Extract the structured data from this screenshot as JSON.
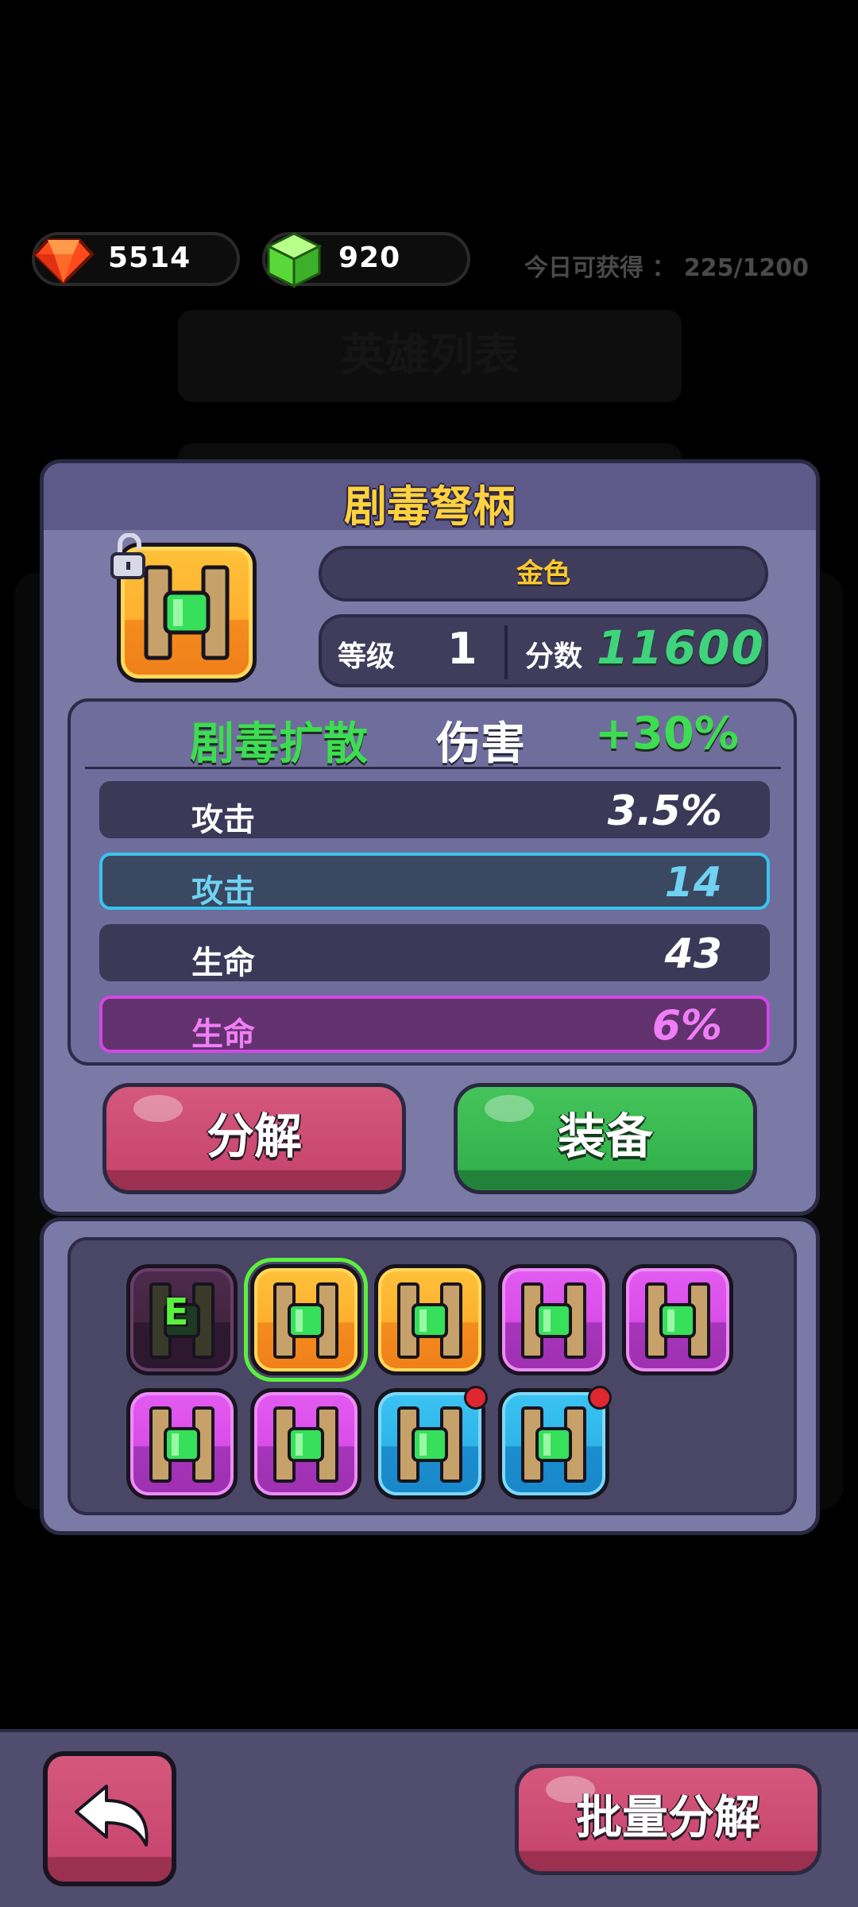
{
  "currency": {
    "gems": "5514",
    "cubes": "920"
  },
  "daily_limit": "今日可获得 ： 225/1200",
  "background": {
    "hero_list_title": "英雄列表"
  },
  "item": {
    "name": "剧毒弩柄",
    "rarity": "金色",
    "level_label": "等级",
    "level": "1",
    "score_label": "分数",
    "score": "11600",
    "skill_name": "剧毒扩散",
    "skill_effect": "伤害",
    "skill_bonus": "+30%",
    "stats": [
      {
        "label": "攻击",
        "value": "3.5%"
      },
      {
        "label": "攻击",
        "value": "14"
      },
      {
        "label": "生命",
        "value": "43"
      },
      {
        "label": "生命",
        "value": "6%"
      }
    ]
  },
  "buttons": {
    "decompose": "分解",
    "equip": "装备",
    "batch_decompose": "批量分解"
  },
  "inventory": [
    {
      "rarity": "dark",
      "equipped": true,
      "badge_text": "E",
      "new": false,
      "selected": false
    },
    {
      "rarity": "orange",
      "equipped": false,
      "new": false,
      "selected": true
    },
    {
      "rarity": "orange",
      "equipped": false,
      "new": false,
      "selected": false
    },
    {
      "rarity": "purple",
      "equipped": false,
      "new": false,
      "selected": false
    },
    {
      "rarity": "purple",
      "equipped": false,
      "new": false,
      "selected": false
    },
    {
      "rarity": "purple",
      "equipped": false,
      "new": false,
      "selected": false
    },
    {
      "rarity": "purple",
      "equipped": false,
      "new": false,
      "selected": false
    },
    {
      "rarity": "blue",
      "equipped": false,
      "new": true,
      "selected": false
    },
    {
      "rarity": "blue",
      "equipped": false,
      "new": true,
      "selected": false
    }
  ],
  "colors": {
    "gold": "#ffd23e",
    "green": "#3ddc52",
    "cyan": "#6fd2f2",
    "magenta": "#f07ef6",
    "panel": "#7b79a6"
  }
}
